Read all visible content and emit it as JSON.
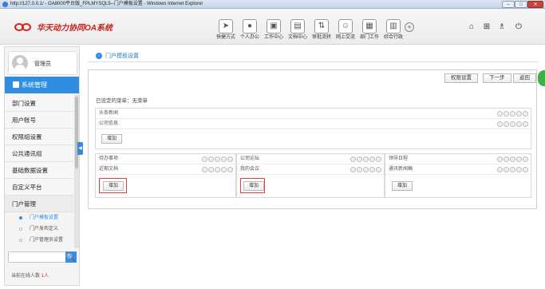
{
  "window": {
    "title": "http://127.0.0.1/ - OA8000平台版_FPLMYSQL5--门户模板设置 - Windows Internet Explorer",
    "minimize": "–",
    "maximize": "□",
    "close": "✕"
  },
  "header": {
    "logo_text": "华天动力协同OA系统",
    "toolbar": [
      {
        "label": "快捷方式",
        "icon": "send-icon",
        "glyph": "➤"
      },
      {
        "label": "个人办公",
        "icon": "person-icon",
        "glyph": "●"
      },
      {
        "label": "工作中心",
        "icon": "briefcase-icon",
        "glyph": "▣"
      },
      {
        "label": "文档中心",
        "icon": "folder-icon",
        "glyph": "▤"
      },
      {
        "label": "审批流转",
        "icon": "flow-icon",
        "glyph": "⇅"
      },
      {
        "label": "网上交流",
        "icon": "chat-icon",
        "glyph": "☺"
      },
      {
        "label": "部门工作",
        "icon": "department-icon",
        "glyph": "▦"
      },
      {
        "label": "综合行政",
        "icon": "admin-icon",
        "glyph": "▥"
      }
    ],
    "plus": "+",
    "right_icons": [
      {
        "name": "home-icon",
        "glyph": "⌂"
      },
      {
        "name": "grid-icon",
        "glyph": "⊞"
      },
      {
        "name": "shirt-icon",
        "glyph": "♗"
      },
      {
        "name": "power-icon",
        "glyph": "⏻"
      }
    ]
  },
  "sidebar": {
    "user": "管理员",
    "section": "系统管理",
    "items": [
      "部门设置",
      "用户账号",
      "权限组设置",
      "公共通讯组",
      "基础数据设置",
      "自定义平台"
    ],
    "group": "门户管理",
    "sub_items": [
      {
        "label": "门户模板设置",
        "active": true
      },
      {
        "label": "门户发布定义",
        "active": false
      },
      {
        "label": "门户管理员设置",
        "active": false
      }
    ],
    "search_placeholder": "",
    "search_icon": "🔍",
    "online_label": "当前在线人数",
    "online_count": "1人",
    "collapse": "◀"
  },
  "breadcrumb": {
    "arrow": "›",
    "text": "门户模板设置"
  },
  "main": {
    "buttons": {
      "permission": "权限设置",
      "next": "下一步",
      "back": "返回"
    },
    "selected_label": "已设定的菜单：无菜单",
    "top_panel": {
      "rows": [
        "头条新闻",
        "公司信息"
      ],
      "add": "增加"
    },
    "columns": [
      {
        "rows": [
          "待办事项",
          "近期文档"
        ],
        "add": "增加"
      },
      {
        "rows": [
          "公司论坛",
          "我的会议"
        ],
        "add": "增加"
      },
      {
        "rows": [
          "领导日程",
          "通讯新闻稿"
        ],
        "add": "增加"
      }
    ],
    "ctrl_glyphs": [
      "·",
      "·",
      "·",
      "·",
      "·"
    ]
  }
}
